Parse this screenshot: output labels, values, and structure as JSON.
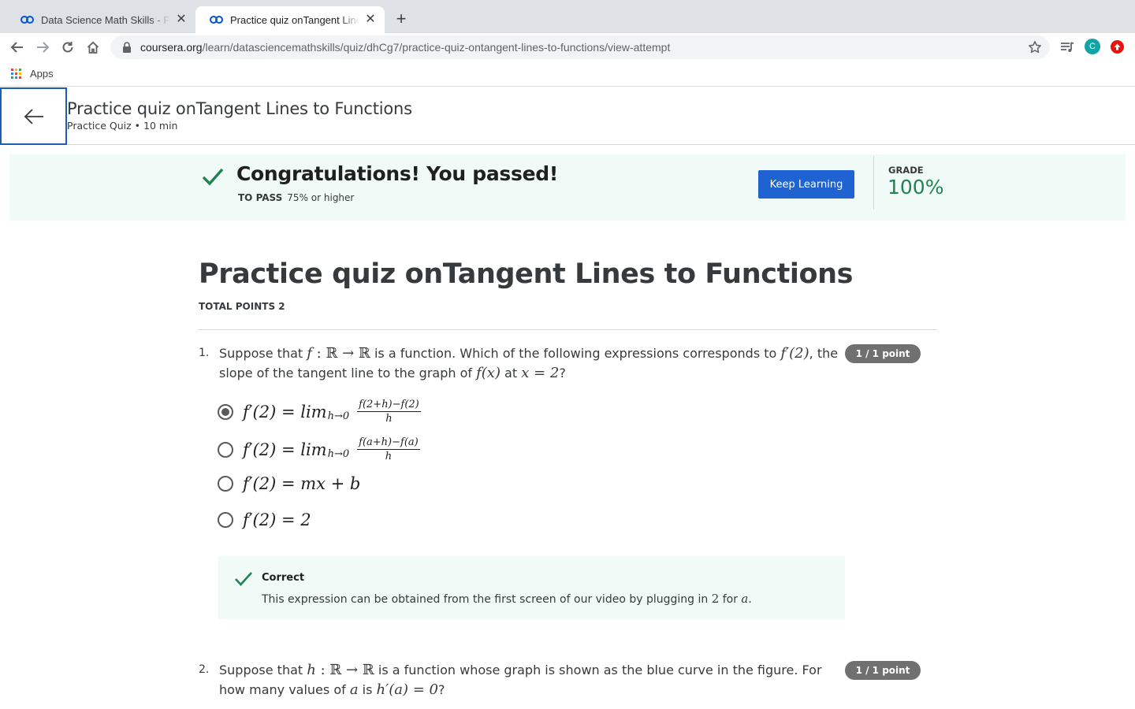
{
  "browser": {
    "tabs": [
      {
        "title": "Data Science Math Skills - Fun",
        "active": false
      },
      {
        "title": "Practice quiz onTangent Lines t",
        "active": true
      }
    ],
    "url_host": "coursera.org",
    "url_path": "/learn/datasciencemathskills/quiz/dhCg7/practice-quiz-ontangent-lines-to-functions/view-attempt",
    "profile_initial": "C",
    "bookmarks": {
      "apps_label": "Apps"
    }
  },
  "header": {
    "title": "Practice quiz onTangent Lines to Functions",
    "subtitle": "Practice Quiz • 10 min"
  },
  "result": {
    "message": "Congratulations! You passed!",
    "to_pass_label": "TO PASS",
    "to_pass_value": "75% or higher",
    "keep_learning_label": "Keep Learning",
    "grade_label": "GRADE",
    "grade_value": "100%"
  },
  "quiz": {
    "title": "Practice quiz onTangent Lines to Functions",
    "total_points": "TOTAL POINTS 2",
    "questions": [
      {
        "number": "1.",
        "points": "1 / 1 point",
        "text_parts": [
          "Suppose that ",
          "f",
          " : ",
          "ℝ → ℝ",
          " is a function. Which of the following expressions corresponds to ",
          "f′(2)",
          ", the slope of the tangent line to the graph of ",
          "f(x)",
          " at ",
          "x = 2",
          "?"
        ],
        "options": [
          {
            "lhs": "f′(2) = lim",
            "sub": "h→0",
            "num": "f(2+h)−f(2)",
            "den": "h",
            "selected": true
          },
          {
            "lhs": "f′(2) = lim",
            "sub": "h→0",
            "num": "f(a+h)−f(a)",
            "den": "h",
            "selected": false
          },
          {
            "lhs": "f′(2) = mx + b",
            "selected": false
          },
          {
            "lhs": "f′(2) = 2",
            "selected": false
          }
        ],
        "feedback": {
          "title": "Correct",
          "text_parts": [
            "This expression can be obtained from the first screen of our video by plugging in ",
            "2",
            " for ",
            "a",
            "."
          ]
        }
      },
      {
        "number": "2.",
        "points": "1 / 1 point",
        "text_parts": [
          "Suppose that ",
          "h",
          " : ",
          "ℝ → ℝ",
          " is a function whose graph is shown as the blue curve in the figure. For how many values of ",
          "a",
          " is ",
          "h′(a) = 0",
          "?"
        ]
      }
    ]
  },
  "colors": {
    "accent_blue": "#1f62d1",
    "success_green": "#1f8354",
    "banner_bg": "#f0faf6",
    "badge_gray": "#707070"
  }
}
